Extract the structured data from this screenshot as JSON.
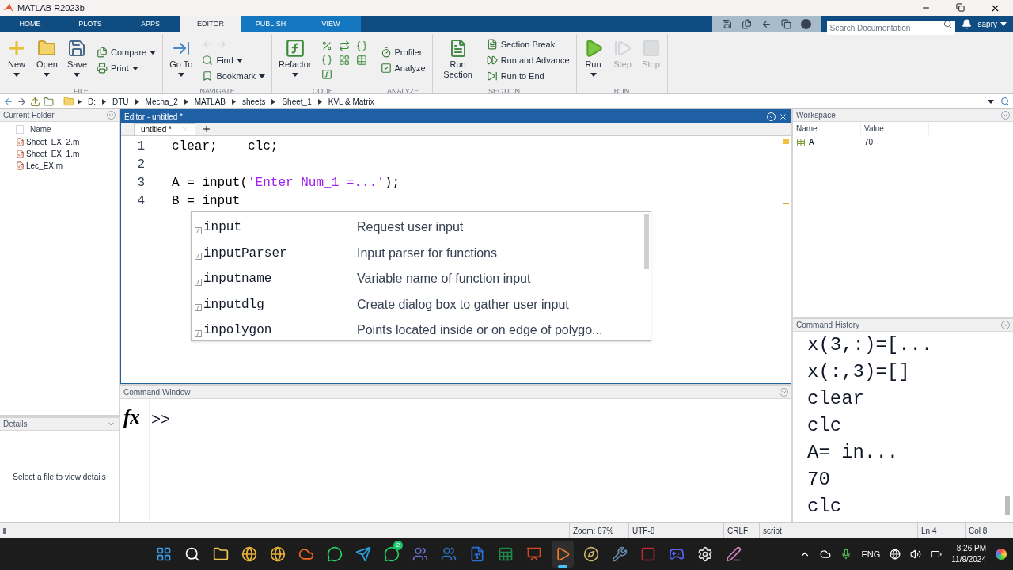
{
  "window": {
    "title": "MATLAB R2023b"
  },
  "ribbon_tabs": [
    {
      "label": "HOME",
      "selected": false
    },
    {
      "label": "PLOTS",
      "selected": false
    },
    {
      "label": "APPS",
      "selected": false
    },
    {
      "label": "EDITOR",
      "selected": true
    },
    {
      "label": "PUBLISH",
      "selected": false
    },
    {
      "label": "VIEW",
      "selected": false
    }
  ],
  "search": {
    "placeholder": "Search Documentation"
  },
  "user": {
    "name": "sapry"
  },
  "ribbon_groups": [
    {
      "title": "FILE",
      "items": [
        {
          "kind": "large",
          "label": "New",
          "dropdown": true,
          "disabled": false
        },
        {
          "kind": "large",
          "label": "Open",
          "dropdown": true,
          "disabled": false
        },
        {
          "kind": "large",
          "label": "Save",
          "dropdown": true,
          "disabled": false
        },
        {
          "kind": "small",
          "label": "Compare",
          "dropdown": true,
          "disabled": false
        },
        {
          "kind": "small",
          "label": "Print",
          "dropdown": true,
          "disabled": false
        }
      ]
    },
    {
      "title": "NAVIGATE",
      "items": [
        {
          "kind": "large",
          "label": "Go To",
          "dropdown": true,
          "disabled": false
        },
        {
          "kind": "arrows",
          "disabled": true
        },
        {
          "kind": "small",
          "label": "Find",
          "dropdown": true,
          "disabled": false
        },
        {
          "kind": "small",
          "label": "Bookmark",
          "dropdown": true,
          "disabled": false
        }
      ]
    },
    {
      "title": "CODE",
      "items": [
        {
          "kind": "large",
          "label": "Refactor",
          "dropdown": true,
          "disabled": false
        },
        {
          "kind": "icons",
          "disabled": false
        }
      ]
    },
    {
      "title": "ANALYZE",
      "items": [
        {
          "kind": "small",
          "label": "Profiler",
          "dropdown": false,
          "disabled": false
        },
        {
          "kind": "small",
          "label": "Analyze",
          "dropdown": false,
          "disabled": false
        }
      ]
    },
    {
      "title": "SECTION",
      "items": [
        {
          "kind": "large",
          "label": "Run Section",
          "dropdown": false,
          "disabled": false
        },
        {
          "kind": "small",
          "label": "Section Break",
          "dropdown": false,
          "disabled": false
        },
        {
          "kind": "small",
          "label": "Run and Advance",
          "dropdown": false,
          "disabled": false
        },
        {
          "kind": "small",
          "label": "Run to End",
          "dropdown": false,
          "disabled": false
        }
      ]
    },
    {
      "title": "RUN",
      "items": [
        {
          "kind": "large",
          "label": "Run",
          "dropdown": true,
          "disabled": false
        },
        {
          "kind": "large",
          "label": "Step",
          "dropdown": false,
          "disabled": true
        },
        {
          "kind": "large",
          "label": "Stop",
          "dropdown": false,
          "disabled": true
        }
      ]
    }
  ],
  "address": [
    "D:",
    "DTU",
    "Mecha_2",
    "MATLAB",
    "sheets",
    "Sheet_1",
    "KVL & Matrix"
  ],
  "current_folder": {
    "title": "Current Folder",
    "select_all": {
      "checked": false
    },
    "column": "Name",
    "files": [
      "Sheet_EX_2.m",
      "Sheet_EX_1.m",
      "Lec_EX.m"
    ]
  },
  "details": {
    "title": "Details",
    "message": "Select a file to view details"
  },
  "editor": {
    "title": "Editor - untitled *",
    "tabs": [
      {
        "label": "untitled *",
        "selected": true
      }
    ],
    "lines": [
      {
        "number": "1",
        "segments": [
          {
            "kind": "code",
            "text": "clear;    clc;"
          }
        ]
      },
      {
        "number": "2"
      },
      {
        "number": "3",
        "segments": [
          {
            "kind": "code",
            "text": "A = input("
          },
          {
            "kind": "string",
            "text": "'Enter Num_1 =...'"
          },
          {
            "kind": "code",
            "text": ");"
          }
        ]
      },
      {
        "number": "4",
        "segments": [
          {
            "kind": "code",
            "text": "B = input"
          }
        ]
      }
    ],
    "completions": [
      {
        "name": "input",
        "description": "Request user input"
      },
      {
        "name": "inputParser",
        "description": "Input parser for functions"
      },
      {
        "name": "inputname",
        "description": "Variable name of function input"
      },
      {
        "name": "inputdlg",
        "description": "Create dialog box to gather user input"
      },
      {
        "name": "inpolygon",
        "description": "Points located inside or on edge of polygo..."
      }
    ]
  },
  "command_window": {
    "title": "Command Window",
    "fx": "fx",
    "prompt": ">>"
  },
  "workspace": {
    "title": "Workspace",
    "columns": [
      "Name",
      "Value"
    ],
    "rows": [
      {
        "name": "A",
        "value": "70"
      }
    ]
  },
  "command_history": {
    "title": "Command History",
    "entries": [
      "x(3,:)=[...",
      "x(:,3)=[]",
      "clear",
      "clc",
      "A= in...",
      "70",
      "clc"
    ]
  },
  "status_bar": [
    "Zoom: 67%",
    "UTF-8",
    "CRLF",
    "script",
    "Ln 4",
    "Col 8"
  ],
  "taskbar": {
    "apps": [
      {
        "kind": "start",
        "selected": false
      },
      {
        "kind": "search",
        "selected": false
      },
      {
        "kind": "files",
        "selected": false
      },
      {
        "kind": "browser",
        "selected": false
      },
      {
        "kind": "browser",
        "selected": false
      },
      {
        "kind": "cloud",
        "selected": false
      },
      {
        "kind": "chat",
        "selected": false
      },
      {
        "kind": "plane",
        "selected": false
      },
      {
        "kind": "chat",
        "selected": false,
        "badge": "2"
      },
      {
        "kind": "team",
        "selected": false
      },
      {
        "kind": "in",
        "selected": false
      },
      {
        "kind": "doc",
        "selected": false
      },
      {
        "kind": "sheet",
        "selected": false
      },
      {
        "kind": "slides",
        "selected": false
      },
      {
        "kind": "matlab",
        "selected": true
      },
      {
        "kind": "compass",
        "selected": false
      },
      {
        "kind": "tool",
        "selected": false
      },
      {
        "kind": "cad",
        "selected": false
      },
      {
        "kind": "game",
        "selected": false
      },
      {
        "kind": "gear",
        "selected": false
      },
      {
        "kind": "pen",
        "selected": false
      }
    ],
    "language": "ENG",
    "time": "8:26 PM",
    "date": "11/9/2024"
  }
}
